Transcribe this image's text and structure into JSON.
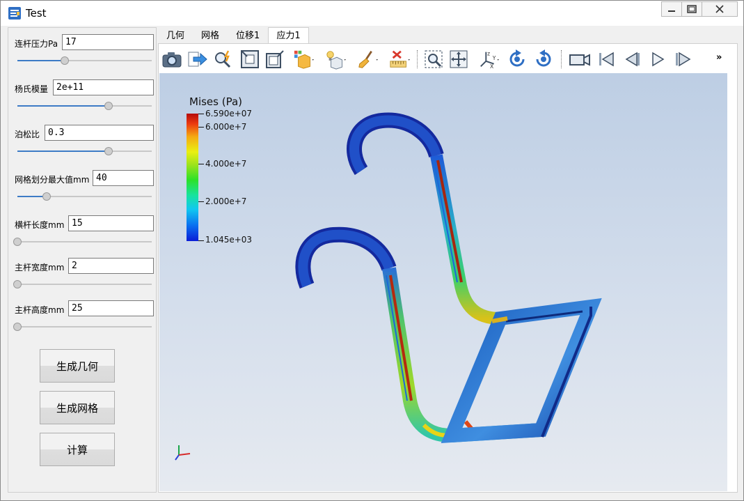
{
  "window": {
    "title": "Test"
  },
  "params": [
    {
      "label": "连杆压力Pa",
      "value": "17",
      "slider": 0.35
    },
    {
      "label": "杨氏模量",
      "value": "2e+11",
      "slider": 0.68
    },
    {
      "label": "泊松比",
      "value": "0.3",
      "slider": 0.68
    },
    {
      "label": "网格划分最大值mm",
      "value": "40",
      "slider": 0.22
    },
    {
      "label": "横杆长度mm",
      "value": "15",
      "slider": 0.0
    },
    {
      "label": "主杆宽度mm",
      "value": "2",
      "slider": 0.0
    },
    {
      "label": "主杆高度mm",
      "value": "25",
      "slider": 0.0
    }
  ],
  "buttons": {
    "generate_geometry": "生成几何",
    "generate_mesh": "生成网格",
    "compute": "计算"
  },
  "tabs": [
    "几何",
    "网格",
    "位移1",
    "应力1"
  ],
  "active_tab": "应力1",
  "toolbar": {
    "icons": [
      "camera-icon",
      "export-icon",
      "query-icon",
      "fit-view-icon",
      "view-box-icon",
      "color-display-icon",
      "render-mode-icon",
      "brush-icon",
      "ruler-clear-icon",
      "zoom-window-icon",
      "pan-icon",
      "axes-orient-icon",
      "rotate-cw-icon",
      "rotate-ccw-icon",
      "camera-record-icon",
      "first-frame-icon",
      "prev-frame-icon",
      "play-icon",
      "next-frame-icon"
    ],
    "more": "»"
  },
  "legend": {
    "title": "Mises (Pa)",
    "ticks": [
      "6.590e+07",
      "6.000e+7",
      "4.000e+7",
      "2.000e+7",
      "1.045e+03"
    ]
  },
  "colors": {
    "accent": "#3d7bc6",
    "stress_max": "#b50b0b",
    "stress_min": "#0a1cd6"
  }
}
